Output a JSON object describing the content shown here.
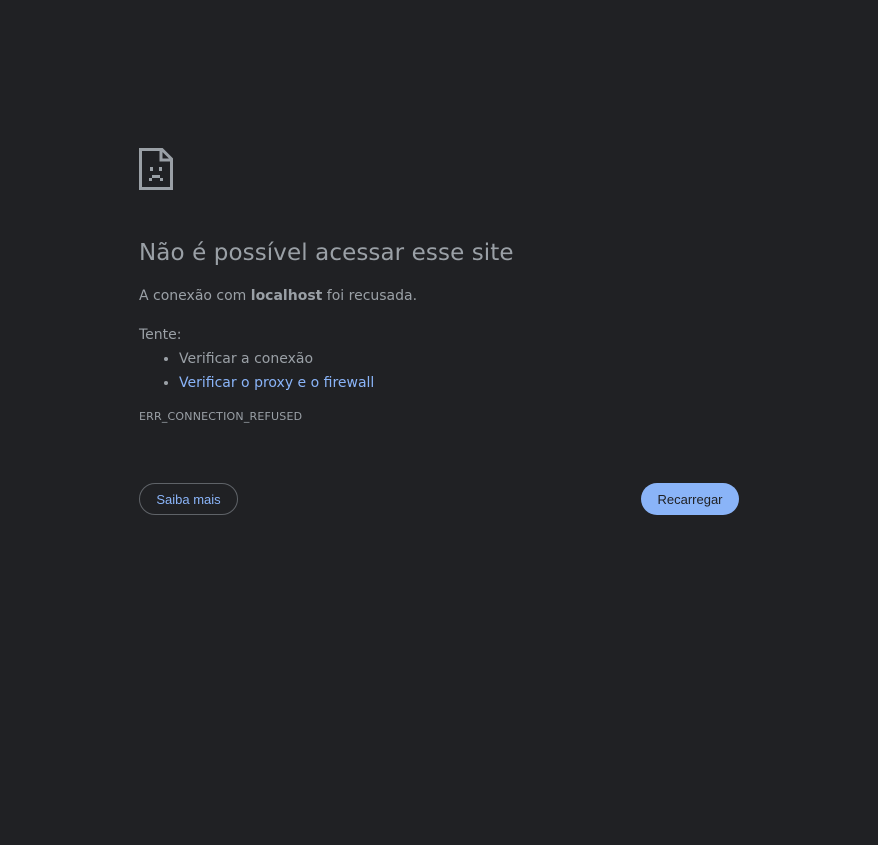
{
  "error": {
    "icon": "sad-page-icon",
    "title": "Não é possível acessar esse site",
    "summary_prefix": "A conexão com ",
    "host": "localhost",
    "summary_suffix": " foi recusada.",
    "try_label": "Tente:",
    "suggestions": [
      {
        "label": "Verificar a conexão",
        "is_link": false
      },
      {
        "label": "Verificar o proxy e o firewall",
        "is_link": true
      }
    ],
    "code": "ERR_CONNECTION_REFUSED"
  },
  "buttons": {
    "learn_more": "Saiba mais",
    "reload": "Recarregar"
  },
  "colors": {
    "background": "#202124",
    "text": "#9aa0a6",
    "link": "#8ab4f8",
    "primary_button": "#8ab4f8"
  }
}
